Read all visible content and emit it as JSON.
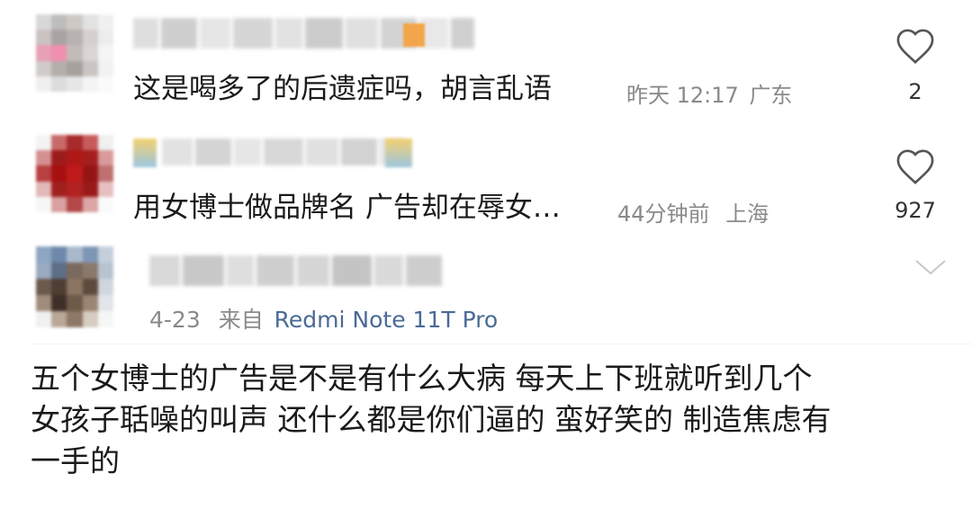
{
  "comments": [
    {
      "text": "这是喝多了的后遗症吗，胡言乱语",
      "time": "昨天 12:17",
      "location": "广东",
      "likes": "2",
      "avatar_colors": [
        "#d8d8d8",
        "#bdbdbd",
        "#cfc9c6",
        "#e2e2e2",
        "#f0f0f0",
        "#c9c3c0",
        "#a9a4a2",
        "#b8b2b0",
        "#d5d0cd",
        "#ececec",
        "#e8a0b4",
        "#f08fb0",
        "#c2bcb9",
        "#dad5d3",
        "#f5f5f5",
        "#d0cbc8",
        "#b5afac",
        "#a7a19e",
        "#cac5c2",
        "#f2f2f2",
        "#efefef",
        "#dcdcdc",
        "#e6e6e6",
        "#f4f4f4",
        "#fafafa"
      ]
    },
    {
      "text": "用女博士做品牌名 广告却在辱女…",
      "time": "44分钟前",
      "location": "上海",
      "likes": "927",
      "avatar_colors": [
        "#f3f3f3",
        "#c86a6a",
        "#a82a2a",
        "#c85a5a",
        "#f0f0f0",
        "#d49090",
        "#9c1c1c",
        "#b01818",
        "#a51e1e",
        "#d89a9a",
        "#b84040",
        "#a81010",
        "#c01a1a",
        "#951515",
        "#c07070",
        "#e2b8b8",
        "#a02020",
        "#b22222",
        "#9a1a1a",
        "#e6c0c0",
        "#f7f7f7",
        "#d8a0a0",
        "#b44848",
        "#dba6a6",
        "#fafafa"
      ]
    }
  ],
  "post": {
    "date": "4-23",
    "via_prefix": "来自",
    "device": "Redmi Note 11T Pro",
    "lines": [
      "五个女博士的广告是不是有什么大病 每天上下班就听到几个",
      "女孩子聒噪的叫声 还什么都是你们逼的 蛮好笑的 制造焦虑有",
      "一手的"
    ],
    "avatar_colors": [
      "#8fa6c2",
      "#6d88ab",
      "#a9b9cc",
      "#7e96b6",
      "#c4cfdb",
      "#9aaac0",
      "#5d6e86",
      "#7a6a5e",
      "#8b7a6b",
      "#b8c3d2",
      "#6b5a4c",
      "#4e3e33",
      "#8a7462",
      "#5c4a3c",
      "#d0d6de",
      "#a08c7a",
      "#3e3028",
      "#6e5a49",
      "#9b8574",
      "#e2e5ea",
      "#f0f0f0",
      "#b9a797",
      "#8d7765",
      "#d6ccc2",
      "#f6f6f6"
    ]
  },
  "colors": {
    "like_icon": "#555555",
    "meta_text": "#8a8a8a",
    "device_link": "#4a6a96",
    "chevron": "#c8c8c8"
  }
}
